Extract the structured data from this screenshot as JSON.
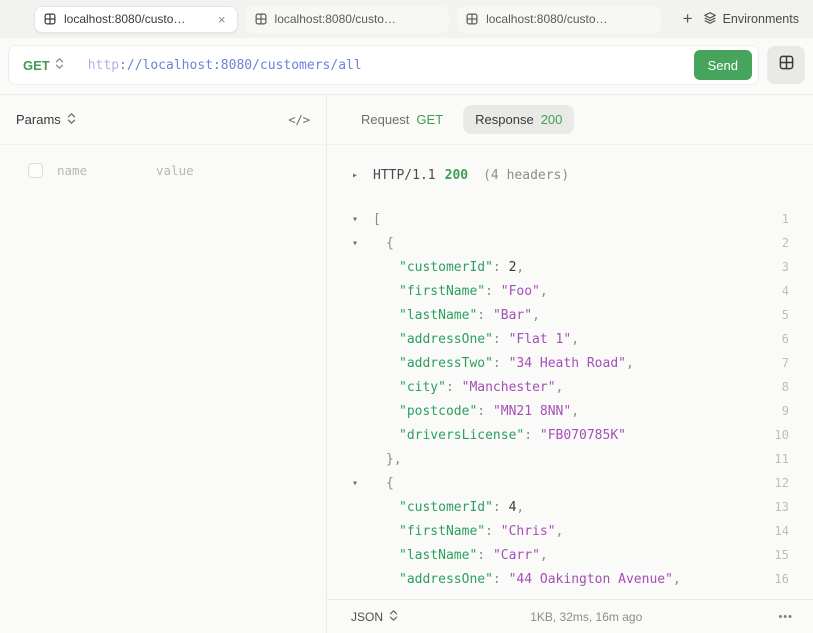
{
  "tabbar": {
    "tabs": [
      {
        "label": "localhost:8080/custo…",
        "active": true
      },
      {
        "label": "localhost:8080/custo…",
        "active": false
      },
      {
        "label": "localhost:8080/custo…",
        "active": false
      }
    ],
    "tab_close_label": "×",
    "new_tab_label": "+",
    "environments_label": "Environments"
  },
  "request_bar": {
    "method": "GET",
    "url_scheme": "http",
    "url_rest": "://localhost:8080/customers/all",
    "send_label": "Send"
  },
  "params_panel": {
    "title": "Params",
    "code_icon_label": "</>",
    "name_placeholder": "name",
    "value_placeholder": "value"
  },
  "response_panel": {
    "request_tab_label": "Request",
    "request_tab_method": "GET",
    "response_tab_label": "Response",
    "response_tab_status": "200",
    "collapse_arrow_right": "▸",
    "collapse_arrow_down": "▾",
    "http_protocol": "HTTP/1.1",
    "http_status": "200",
    "http_headers": "(4 headers)",
    "footer_format": "JSON",
    "footer_meta": "1KB, 32ms, 16m ago",
    "footer_more": "•••"
  },
  "colors": {
    "accent_green": "#47a45c",
    "url_blue": "#6d82d9",
    "json_key_green": "#2f9e62",
    "json_string_purple": "#a54fb8"
  },
  "response_lines": [
    {
      "arrow": true,
      "indent": 0,
      "n": "1",
      "tokens": [
        {
          "c": "punct",
          "t": "["
        }
      ]
    },
    {
      "arrow": true,
      "indent": 1,
      "n": "2",
      "tokens": [
        {
          "c": "punct",
          "t": "{"
        }
      ]
    },
    {
      "arrow": false,
      "indent": 2,
      "n": "3",
      "tokens": [
        {
          "c": "key",
          "t": "\"customerId\""
        },
        {
          "c": "punct",
          "t": ": "
        },
        {
          "c": "num",
          "t": "2"
        },
        {
          "c": "punct",
          "t": ","
        }
      ]
    },
    {
      "arrow": false,
      "indent": 2,
      "n": "4",
      "tokens": [
        {
          "c": "key",
          "t": "\"firstName\""
        },
        {
          "c": "punct",
          "t": ": "
        },
        {
          "c": "str",
          "t": "\"Foo\""
        },
        {
          "c": "punct",
          "t": ","
        }
      ]
    },
    {
      "arrow": false,
      "indent": 2,
      "n": "5",
      "tokens": [
        {
          "c": "key",
          "t": "\"lastName\""
        },
        {
          "c": "punct",
          "t": ": "
        },
        {
          "c": "str",
          "t": "\"Bar\""
        },
        {
          "c": "punct",
          "t": ","
        }
      ]
    },
    {
      "arrow": false,
      "indent": 2,
      "n": "6",
      "tokens": [
        {
          "c": "key",
          "t": "\"addressOne\""
        },
        {
          "c": "punct",
          "t": ": "
        },
        {
          "c": "str",
          "t": "\"Flat 1\""
        },
        {
          "c": "punct",
          "t": ","
        }
      ]
    },
    {
      "arrow": false,
      "indent": 2,
      "n": "7",
      "tokens": [
        {
          "c": "key",
          "t": "\"addressTwo\""
        },
        {
          "c": "punct",
          "t": ": "
        },
        {
          "c": "str",
          "t": "\"34 Heath Road\""
        },
        {
          "c": "punct",
          "t": ","
        }
      ]
    },
    {
      "arrow": false,
      "indent": 2,
      "n": "8",
      "tokens": [
        {
          "c": "key",
          "t": "\"city\""
        },
        {
          "c": "punct",
          "t": ": "
        },
        {
          "c": "str",
          "t": "\"Manchester\""
        },
        {
          "c": "punct",
          "t": ","
        }
      ]
    },
    {
      "arrow": false,
      "indent": 2,
      "n": "9",
      "tokens": [
        {
          "c": "key",
          "t": "\"postcode\""
        },
        {
          "c": "punct",
          "t": ": "
        },
        {
          "c": "str",
          "t": "\"MN21 8NN\""
        },
        {
          "c": "punct",
          "t": ","
        }
      ]
    },
    {
      "arrow": false,
      "indent": 2,
      "n": "10",
      "tokens": [
        {
          "c": "key",
          "t": "\"driversLicense\""
        },
        {
          "c": "punct",
          "t": ": "
        },
        {
          "c": "str",
          "t": "\"FB070785K\""
        }
      ]
    },
    {
      "arrow": false,
      "indent": 1,
      "n": "11",
      "tokens": [
        {
          "c": "punct",
          "t": "},"
        }
      ]
    },
    {
      "arrow": true,
      "indent": 1,
      "n": "12",
      "tokens": [
        {
          "c": "punct",
          "t": "{"
        }
      ]
    },
    {
      "arrow": false,
      "indent": 2,
      "n": "13",
      "tokens": [
        {
          "c": "key",
          "t": "\"customerId\""
        },
        {
          "c": "punct",
          "t": ": "
        },
        {
          "c": "num",
          "t": "4"
        },
        {
          "c": "punct",
          "t": ","
        }
      ]
    },
    {
      "arrow": false,
      "indent": 2,
      "n": "14",
      "tokens": [
        {
          "c": "key",
          "t": "\"firstName\""
        },
        {
          "c": "punct",
          "t": ": "
        },
        {
          "c": "str",
          "t": "\"Chris\""
        },
        {
          "c": "punct",
          "t": ","
        }
      ]
    },
    {
      "arrow": false,
      "indent": 2,
      "n": "15",
      "tokens": [
        {
          "c": "key",
          "t": "\"lastName\""
        },
        {
          "c": "punct",
          "t": ": "
        },
        {
          "c": "str",
          "t": "\"Carr\""
        },
        {
          "c": "punct",
          "t": ","
        }
      ]
    },
    {
      "arrow": false,
      "indent": 2,
      "n": "16",
      "tokens": [
        {
          "c": "key",
          "t": "\"addressOne\""
        },
        {
          "c": "punct",
          "t": ": "
        },
        {
          "c": "str",
          "t": "\"44 Oakington Avenue\""
        },
        {
          "c": "punct",
          "t": ","
        }
      ]
    }
  ]
}
